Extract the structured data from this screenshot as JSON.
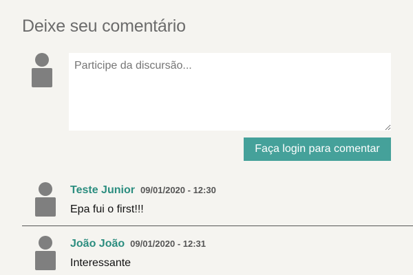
{
  "section": {
    "title": "Deixe seu comentário"
  },
  "form": {
    "placeholder": "Participe da discursão...",
    "value": "",
    "login_button_label": "Faça login para comentar"
  },
  "comments": [
    {
      "author": "Teste Junior",
      "timestamp": "09/01/2020 - 12:30",
      "text": "Epa fui o first!!!"
    },
    {
      "author": "João João",
      "timestamp": "09/01/2020 - 12:31",
      "text": "Interessante"
    }
  ],
  "colors": {
    "background": "#f5f4f0",
    "accent": "#45a19a",
    "author": "#2b8d7f",
    "avatar": "#7f7f7f"
  },
  "icons": {
    "avatar": "user-silhouette-icon"
  }
}
